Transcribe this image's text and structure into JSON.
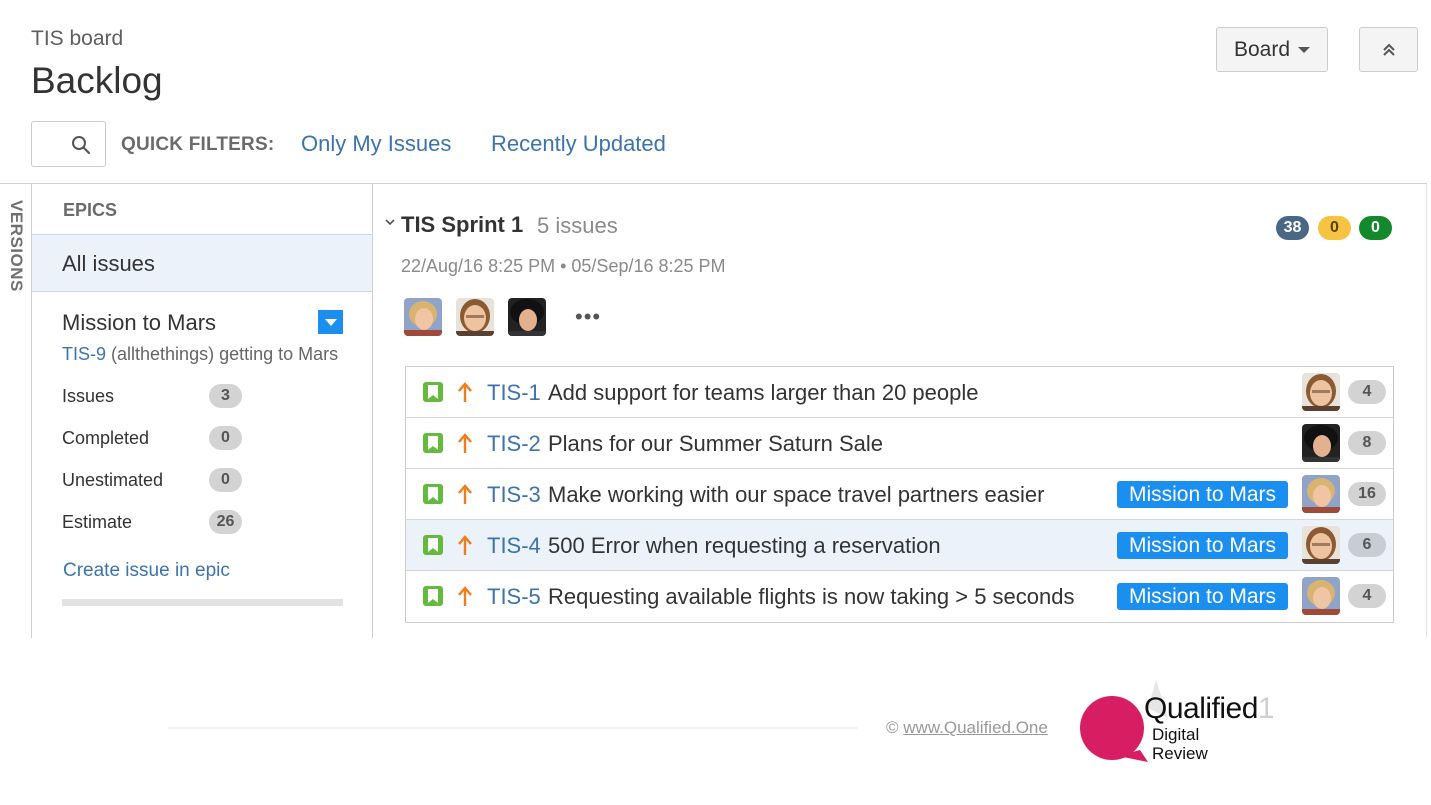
{
  "header": {
    "board_name": "TIS board",
    "page_title": "Backlog",
    "board_button_label": "Board",
    "collapse_icon": "double-chevron-up-icon"
  },
  "quick_filters": {
    "search_placeholder": "",
    "label": "QUICK FILTERS:",
    "filters": [
      "Only My Issues",
      "Recently Updated"
    ]
  },
  "sidebar": {
    "versions_tab_label": "VERSIONS",
    "epics_heading": "EPICS",
    "all_issues_label": "All issues",
    "epic": {
      "name": "Mission to Mars",
      "key": "TIS-9",
      "description": " (allthethings) getting to Mars",
      "stats": [
        {
          "label": "Issues",
          "value": "3"
        },
        {
          "label": "Completed",
          "value": "0"
        },
        {
          "label": "Unestimated",
          "value": "0"
        },
        {
          "label": "Estimate",
          "value": "26"
        }
      ],
      "create_link": "Create issue in epic",
      "progress_percent": 0,
      "color": "#1b8ff0"
    }
  },
  "sprint": {
    "name": "TIS Sprint 1",
    "issue_count": "5 issues",
    "dates": "22/Aug/16 8:25 PM • 05/Sep/16 8:25 PM",
    "status_counts": {
      "todo": "38",
      "in_progress": "0",
      "done": "0"
    },
    "status_colors": {
      "todo": "#4a6785",
      "in_progress": "#f6c342",
      "done": "#14892c"
    },
    "assignees": [
      "avatar-blonde-woman",
      "avatar-bearded-man",
      "avatar-dark-haired-woman"
    ],
    "more_label": "•••",
    "issues": [
      {
        "key": "TIS-1",
        "summary": "Add support for teams larger than 20 people",
        "epic": "",
        "assignee": "avatar-bearded-man",
        "estimate": "4",
        "type": "story-icon",
        "priority": "priority-high-arrow-icon",
        "selected": false
      },
      {
        "key": "TIS-2",
        "summary": "Plans for our Summer Saturn Sale",
        "epic": "",
        "assignee": "avatar-dark-haired-woman",
        "estimate": "8",
        "type": "story-icon",
        "priority": "priority-high-arrow-icon",
        "selected": false
      },
      {
        "key": "TIS-3",
        "summary": "Make working with our space travel partners easier",
        "epic": "Mission to Mars",
        "assignee": "avatar-blonde-woman",
        "estimate": "16",
        "type": "story-icon",
        "priority": "priority-high-arrow-icon",
        "selected": false
      },
      {
        "key": "TIS-4",
        "summary": "500 Error when requesting a reservation",
        "epic": "Mission to Mars",
        "assignee": "avatar-bearded-man",
        "estimate": "6",
        "type": "story-icon",
        "priority": "priority-high-arrow-icon",
        "selected": true
      },
      {
        "key": "TIS-5",
        "summary": "Requesting available flights is now taking > 5 seconds",
        "epic": "Mission to Mars",
        "assignee": "avatar-blonde-woman",
        "estimate": "4",
        "type": "story-icon",
        "priority": "priority-high-arrow-icon",
        "selected": false
      }
    ]
  },
  "footer": {
    "copyright_symbol": "©",
    "copyright_link": "www.Qualified.One",
    "logo_word": "Qualified",
    "logo_one": "1",
    "logo_line1": "Digital",
    "logo_line2": "Review",
    "logo_color": "#d81e63"
  }
}
